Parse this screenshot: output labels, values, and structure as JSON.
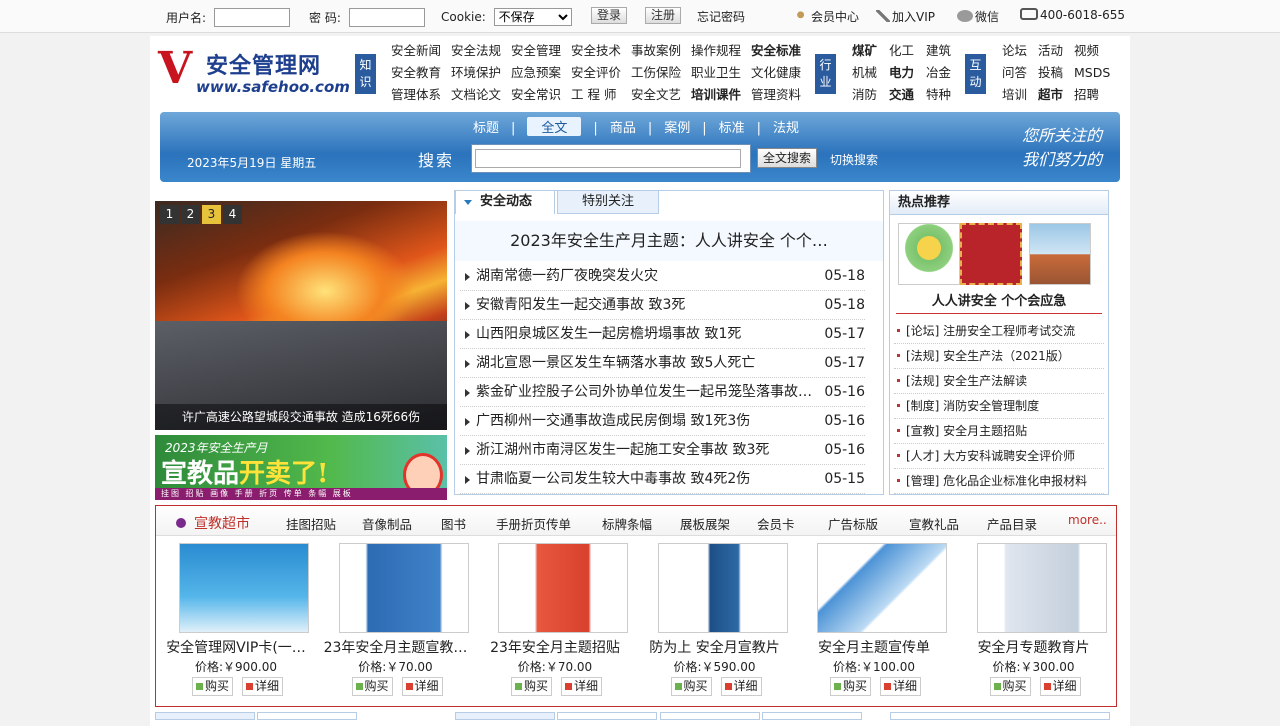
{
  "topbar": {
    "username_label": "用户名:",
    "password_label": "密 码:",
    "cookie_label": "Cookie:",
    "cookie_value": "不保存",
    "login": "登录",
    "register": "注册",
    "forgot": "忘记密码",
    "member": "会员中心",
    "vip": "加入VIP",
    "weixin": "微信",
    "phone": "400-6018-655"
  },
  "logo": {
    "cn": "安全管理网",
    "en": "www.safehoo.com"
  },
  "badges": {
    "zhishi": "知识",
    "hangye": "行业",
    "hudong": "互动"
  },
  "nav": {
    "a": [
      "安全新闻",
      "安全法规",
      "安全管理",
      "安全技术",
      "事故案例",
      "操作规程",
      "安全标准",
      "安全教育",
      "环境保护",
      "应急预案",
      "安全评价",
      "工伤保险",
      "职业卫生",
      "文化健康",
      "管理体系",
      "文档论文",
      "安全常识",
      "工 程 师",
      "安全文艺",
      "培训课件",
      "管理资料"
    ],
    "b": [
      "煤矿",
      "化工",
      "建筑",
      "机械",
      "电力",
      "冶金",
      "消防",
      "交通",
      "特种"
    ],
    "c": [
      "论坛",
      "活动",
      "视频",
      "问答",
      "投稿",
      "MSDS",
      "培训",
      "超市",
      "招聘"
    ]
  },
  "search": {
    "tabs": [
      "标题",
      "全文",
      "商品",
      "案例",
      "标准",
      "法规"
    ],
    "date": "2023年5月19日 星期五",
    "label": "搜索",
    "button": "全文搜索",
    "switch": "切换搜索",
    "slogan1": "您所关注的",
    "slogan2": "我们努力的"
  },
  "slide": {
    "pages": [
      "1",
      "2",
      "3",
      "4"
    ],
    "caption": "许广高速公路望城段交通事故 造成16死66伤"
  },
  "ad": {
    "line1": "2023年安全生产月",
    "line2a": "宣教品",
    "line2b": "开卖了!",
    "line3": "挂图 招贴 画像 手册 折页 传单 条幅 展板"
  },
  "news": {
    "tab_active": "安全动态",
    "tab_other": "特别关注",
    "headline": "2023年安全生产月主题：人人讲安全 个个…",
    "items": [
      {
        "title": "湖南常德一药厂夜晚突发火灾",
        "date": "05-18"
      },
      {
        "title": "安徽青阳发生一起交通事故 致3死",
        "date": "05-18"
      },
      {
        "title": "山西阳泉城区发生一起房檐坍塌事故 致1死",
        "date": "05-17"
      },
      {
        "title": "湖北宣恩一景区发生车辆落水事故 致5人死亡",
        "date": "05-17"
      },
      {
        "title": "紫金矿业控股子公司外协单位发生一起吊笼坠落事故…",
        "date": "05-16"
      },
      {
        "title": "广西柳州一交通事故造成民房倒塌 致1死3伤",
        "date": "05-16"
      },
      {
        "title": "浙江湖州市南浔区发生一起施工安全事故 致3死",
        "date": "05-16"
      },
      {
        "title": "甘肃临夏一公司发生较大中毒事故 致4死2伤",
        "date": "05-15"
      }
    ]
  },
  "hot": {
    "title": "热点推荐",
    "caption": "人人讲安全 个个会应急",
    "items": [
      "[论坛] 注册安全工程师考试交流",
      "[法规] 安全生产法（2021版）",
      "[法规] 安全生产法解读",
      "[制度] 消防安全管理制度",
      "[宣教] 安全月主题招贴",
      "[人才] 大方安科诚聘安全评价师",
      "[管理] 危化品企业标准化申报材料"
    ]
  },
  "shop": {
    "title": "宣教超市",
    "more": "more..",
    "cats": [
      "挂图招贴",
      "音像制品",
      "图书",
      "手册折页传单",
      "标牌条幅",
      "展板展架",
      "会员卡",
      "广告标版",
      "宣教礼品",
      "产品目录"
    ],
    "products": [
      {
        "name": "安全管理网VIP卡(一…",
        "price": "价格:￥900.00"
      },
      {
        "name": "23年安全月主题宣教…",
        "price": "价格:￥70.00"
      },
      {
        "name": "23年安全月主题招贴",
        "price": "价格:￥70.00"
      },
      {
        "name": "防为上 安全月宣教片",
        "price": "价格:￥590.00"
      },
      {
        "name": "安全月主题宣传单",
        "price": "价格:￥100.00"
      },
      {
        "name": "安全月专题教育片",
        "price": "价格:￥300.00"
      }
    ],
    "buy": "购买",
    "detail": "详细"
  },
  "colors": {
    "accent_blue": "#2b73bc",
    "accent_red": "#c0302a"
  }
}
